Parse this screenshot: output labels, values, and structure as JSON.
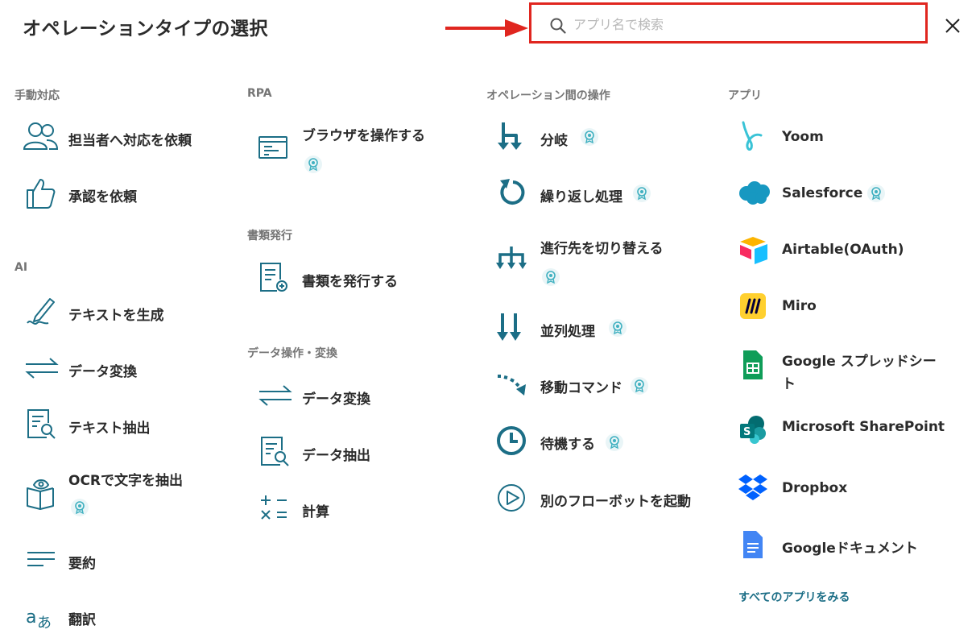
{
  "header": {
    "title": "オペレーションタイプの選択",
    "search_placeholder": "アプリ名で検索"
  },
  "sections": {
    "manual": "手動対応",
    "ai": "AI",
    "rpa": "RPA",
    "doc": "書類発行",
    "data": "データ操作・変換",
    "flow": "オペレーション間の操作",
    "apps": "アプリ"
  },
  "items": {
    "assign": "担当者へ対応を依頼",
    "approve": "承認を依頼",
    "gen_text": "テキストを生成",
    "ai_convert": "データ変換",
    "extract_text": "テキスト抽出",
    "ocr": "OCRで文字を抽出",
    "summary": "要約",
    "translate": "翻訳",
    "browser": "ブラウザを操作する",
    "issue_doc": "書類を発行する",
    "data_convert": "データ変換",
    "data_extract": "データ抽出",
    "calc": "計算",
    "branch": "分岐",
    "loop": "繰り返し処理",
    "switch": "進行先を切り替える",
    "parallel": "並列処理",
    "move": "移動コマンド",
    "wait": "待機する",
    "launch": "別のフローボットを起動"
  },
  "apps": {
    "yoom": "Yoom",
    "salesforce": "Salesforce",
    "airtable": "Airtable(OAuth)",
    "miro": "Miro",
    "gsheets_1": "Google スプレッドシー",
    "gsheets_2": "ト",
    "sharepoint": "Microsoft SharePoint",
    "dropbox": "Dropbox",
    "gdocs": "Googleドキュメント",
    "see_all": "すべてのアプリをみる"
  },
  "colors": {
    "accent": "#1c6e86",
    "highlight": "#e0261f",
    "badge_bg": "#e9f5f7",
    "badge_icon": "#3fb0c0"
  },
  "icons": {
    "badge": "award-badge-icon",
    "search": "search-icon",
    "close": "close-icon"
  }
}
